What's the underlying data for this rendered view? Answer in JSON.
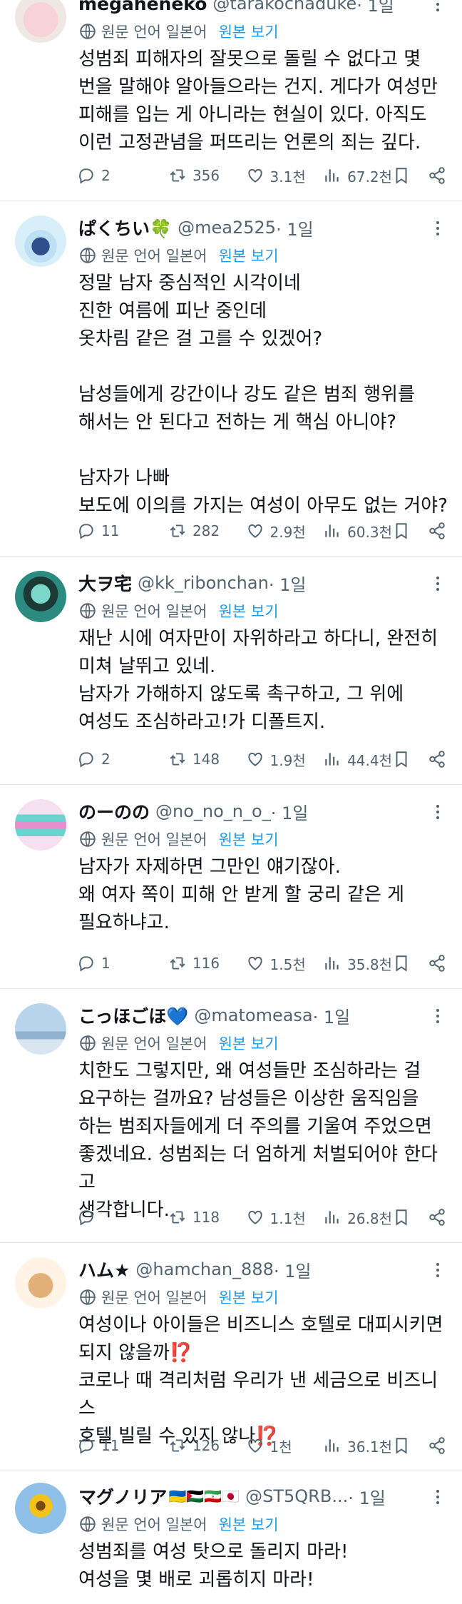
{
  "icons": {
    "translate": "globe-translate-icon",
    "reply": "speech-bubble-icon",
    "retweet": "repost-arrows-icon",
    "like": "heart-icon",
    "views": "bar-chart-icon",
    "bookmark": "bookmark-icon",
    "share": "share-icon",
    "more": "more-dots-icon"
  },
  "colors": {
    "link": "#1d9bf0",
    "muted": "#536471",
    "text": "#0f1419"
  },
  "posts": [
    {
      "name": "megaheneko",
      "handle": "@tarakochaduke",
      "time": "· 1일",
      "translate_label": "원문 언어 일본어",
      "show_original": "원본 보기",
      "text": "성범죄 피해자의 잘못으로 돌릴 수 없다고 몇\n번을 말해야 알아들으라는 건지. 게다가 여성만\n피해를 입는 게 아니라는 현실이 있다. 아직도\n이런 고정관념을 퍼뜨리는 언론의 죄는 깊다.",
      "replies": "2",
      "reposts": "356",
      "likes": "3.1천",
      "views": "67.2천"
    },
    {
      "name": "ぱくちい🍀",
      "handle": "@mea2525",
      "time": "· 1일",
      "translate_label": "원문 언어 일본어",
      "show_original": "원본 보기",
      "text": "정말 남자 중심적인 시각이네\n진한 여름에 피난 중인데\n옷차림 같은 걸 고를 수 있겠어?\n\n남성들에게 강간이나 강도 같은 범죄 행위를\n해서는 안 된다고 전하는 게 핵심 아니야?\n\n남자가 나빠\n보도에 이의를 가지는 여성이 아무도 없는 거야?",
      "replies": "11",
      "reposts": "282",
      "likes": "2.9천",
      "views": "60.3천"
    },
    {
      "name": "大ヲ宅",
      "handle": "@kk_ribonchan",
      "time": "· 1일",
      "translate_label": "원문 언어 일본어",
      "show_original": "원본 보기",
      "text": "재난 시에 여자만이 자위하라고 하다니, 완전히\n미쳐 날뛰고 있네.\n남자가 가해하지 않도록 촉구하고, 그 위에\n여성도 조심하라고!가 디폴트지.",
      "replies": "2",
      "reposts": "148",
      "likes": "1.9천",
      "views": "44.4천"
    },
    {
      "name": "のーのの",
      "handle": "@no_no_n_o_",
      "time": "· 1일",
      "translate_label": "원문 언어 일본어",
      "show_original": "원본 보기",
      "text": "남자가 자제하면 그만인 얘기잖아.\n왜 여자 쪽이 피해 안 받게 할 궁리 같은 게\n필요하냐고.",
      "replies": "1",
      "reposts": "116",
      "likes": "1.5천",
      "views": "35.8천"
    },
    {
      "name": "こっほごほ💙",
      "handle": "@matomeasa",
      "time": "· 1일",
      "translate_label": "원문 언어 일본어",
      "show_original": "원본 보기",
      "text": "치한도 그렇지만, 왜 여성들만 조심하라는 걸\n요구하는 걸까요? 남성들은 이상한 움직임을\n하는 범죄자들에게 더 주의를 기울여 주었으면\n좋겠네요. 성범죄는 더 엄하게 처벌되어야 한다고\n생각합니다.",
      "replies": "",
      "reposts": "118",
      "likes": "1.1천",
      "views": "26.8천"
    },
    {
      "name": "ハム★",
      "handle": "@hamchan_888",
      "time": "· 1일",
      "translate_label": "원문 언어 일본어",
      "show_original": "원본 보기",
      "text": "여성이나 아이들은 비즈니스 호텔로 대피시키면\n되지 않을까⁉️\n코로나 때 격리처럼 우리가 낸 세금으로 비즈니스\n호텔 빌릴 수 있지 않나⁉️",
      "replies": "11",
      "reposts": "126",
      "likes": "1천",
      "views": "36.1천"
    },
    {
      "name": "マグノリア",
      "flags": "🇺🇦🇵🇸🇮🇷🇯🇵",
      "handle": "@ST5QRB...",
      "time": "· 1일",
      "translate_label": "원문 언어 일본어",
      "show_original": "원본 보기",
      "text": "성범죄를 여성 탓으로 돌리지 마라!\n여성을 몇 배로 괴롭히지 마라!"
    }
  ]
}
